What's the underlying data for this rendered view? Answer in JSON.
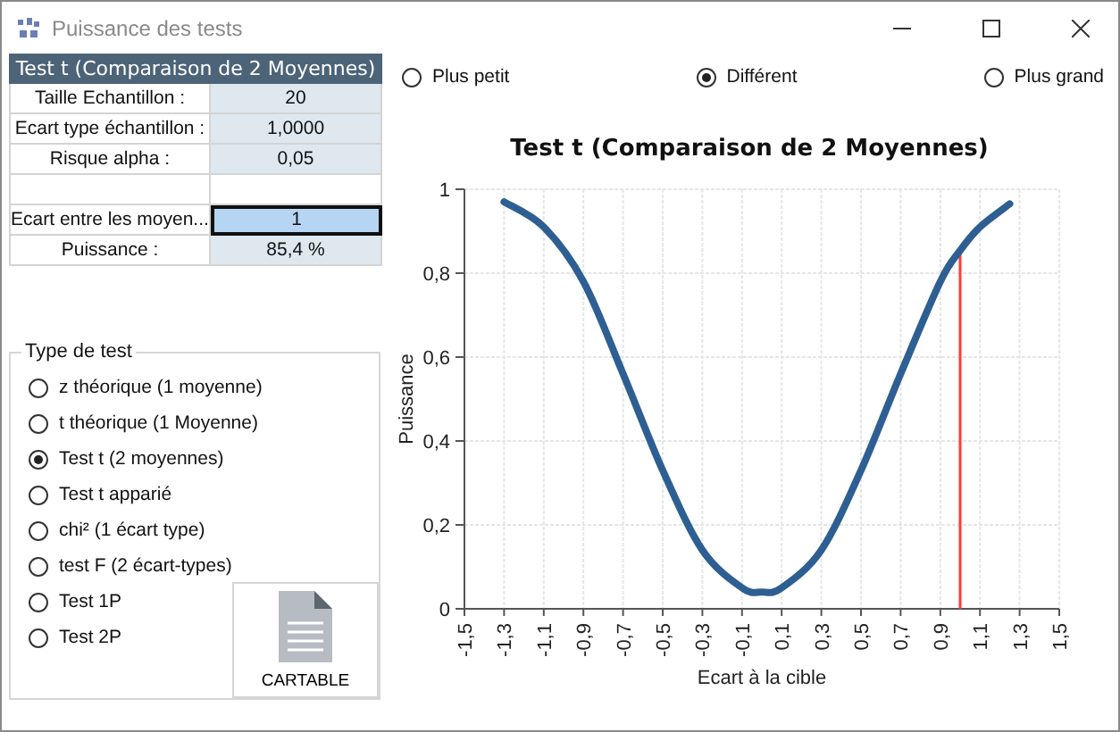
{
  "window": {
    "title": "Puissance des tests"
  },
  "params": {
    "header": "Test t (Comparaison de 2 Moyennes)",
    "rows": [
      {
        "label": "Taille Echantillon :",
        "value": "20",
        "kind": "readonly"
      },
      {
        "label": "Ecart type échantillon :",
        "value": "1,0000",
        "kind": "readonly"
      },
      {
        "label": "Risque alpha :",
        "value": "0,05",
        "kind": "readonly"
      },
      {
        "kind": "blank"
      },
      {
        "label": "Ecart  entre  les  moyen...",
        "value": "1",
        "kind": "input"
      },
      {
        "label": "Puissance :",
        "value": "85,4 %",
        "kind": "readonly"
      }
    ]
  },
  "test_type": {
    "title": "Type de test",
    "options": [
      {
        "label": "z théorique (1 moyenne)",
        "selected": false
      },
      {
        "label": "t théorique (1 Moyenne)",
        "selected": false
      },
      {
        "label": "Test t (2 moyennes)",
        "selected": true
      },
      {
        "label": "Test t apparié",
        "selected": false
      },
      {
        "label": "chi² (1 écart type)",
        "selected": false
      },
      {
        "label": "test F (2 écart-types)",
        "selected": false
      },
      {
        "label": "Test 1P",
        "selected": false
      },
      {
        "label": "Test 2P",
        "selected": false
      }
    ]
  },
  "cartable_button": {
    "label": "CARTABLE"
  },
  "alternative": [
    {
      "label": "Plus petit",
      "selected": false
    },
    {
      "label": "Différent",
      "selected": true
    },
    {
      "label": "Plus grand",
      "selected": false
    }
  ],
  "chart": {
    "chart_data": {
      "type": "line",
      "title": "Test t (Comparaison de 2 Moyennes)",
      "xlabel": "Ecart à la cible",
      "ylabel": "Puissance",
      "x": [
        -1.3,
        -1.1,
        -0.9,
        -0.7,
        -0.5,
        -0.3,
        -0.1,
        0,
        0.1,
        0.3,
        0.5,
        0.7,
        0.9,
        1,
        1.1,
        1.25
      ],
      "series": [
        {
          "color": "#2e5f93",
          "values": [
            0.97,
            0.91,
            0.78,
            0.56,
            0.33,
            0.14,
            0.05,
            0.04,
            0.05,
            0.14,
            0.33,
            0.56,
            0.78,
            0.854,
            0.91,
            0.965
          ]
        }
      ],
      "xlim": [
        -1.5,
        1.5
      ],
      "ylim": [
        0,
        1
      ],
      "xticks": [
        {
          "value": -1.5,
          "label": "-1,5"
        },
        {
          "value": -1.3,
          "label": "-1,3"
        },
        {
          "value": -1.1,
          "label": "-1,1"
        },
        {
          "value": -0.9,
          "label": "-0,9"
        },
        {
          "value": -0.7,
          "label": "-0,7"
        },
        {
          "value": -0.5,
          "label": "-0,5"
        },
        {
          "value": -0.3,
          "label": "-0,3"
        },
        {
          "value": -0.1,
          "label": "-0,1"
        },
        {
          "value": 0.1,
          "label": "0,1"
        },
        {
          "value": 0.3,
          "label": "0,3"
        },
        {
          "value": 0.5,
          "label": "0,5"
        },
        {
          "value": 0.7,
          "label": "0,7"
        },
        {
          "value": 0.9,
          "label": "0,9"
        },
        {
          "value": 1.1,
          "label": "1,1"
        },
        {
          "value": 1.3,
          "label": "1,3"
        },
        {
          "value": 1.5,
          "label": "1,5"
        }
      ],
      "yticks": [
        {
          "value": 0,
          "label": "0"
        },
        {
          "value": 0.2,
          "label": "0,2"
        },
        {
          "value": 0.4,
          "label": "0,4"
        },
        {
          "value": 0.6,
          "label": "0,6"
        },
        {
          "value": 0.8,
          "label": "0,8"
        },
        {
          "value": 1,
          "label": "1"
        }
      ],
      "grid": true,
      "ref_lines": [
        {
          "axis": "x",
          "value": 1,
          "color": "#ff3b3b"
        }
      ]
    }
  }
}
